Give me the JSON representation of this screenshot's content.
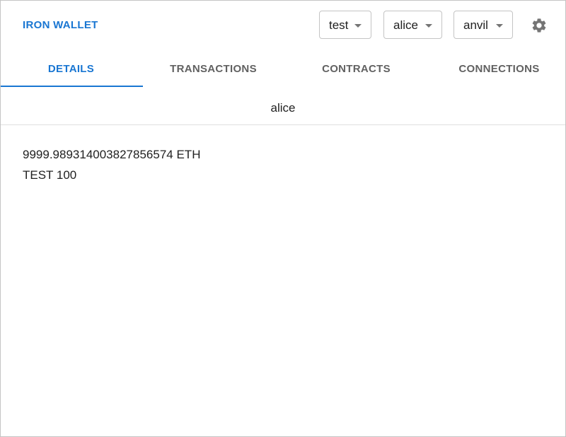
{
  "app": {
    "title": "IRON WALLET"
  },
  "header": {
    "profile_select": {
      "value": "test"
    },
    "account_select": {
      "value": "alice"
    },
    "network_select": {
      "value": "anvil"
    },
    "settings_icon": "gear-icon"
  },
  "tabs": [
    {
      "label": "DETAILS",
      "active": true
    },
    {
      "label": "TRANSACTIONS",
      "active": false
    },
    {
      "label": "CONTRACTS",
      "active": false
    },
    {
      "label": "CONNECTIONS",
      "active": false
    }
  ],
  "details": {
    "account_name": "alice",
    "balances": [
      {
        "amount": "9999.989314003827856574",
        "symbol": "ETH"
      },
      {
        "symbol": "TEST",
        "amount": "100"
      }
    ]
  },
  "colors": {
    "accent": "#1976d2",
    "tab_inactive": "#616161",
    "text": "#212121",
    "border": "#c4c4c4"
  }
}
